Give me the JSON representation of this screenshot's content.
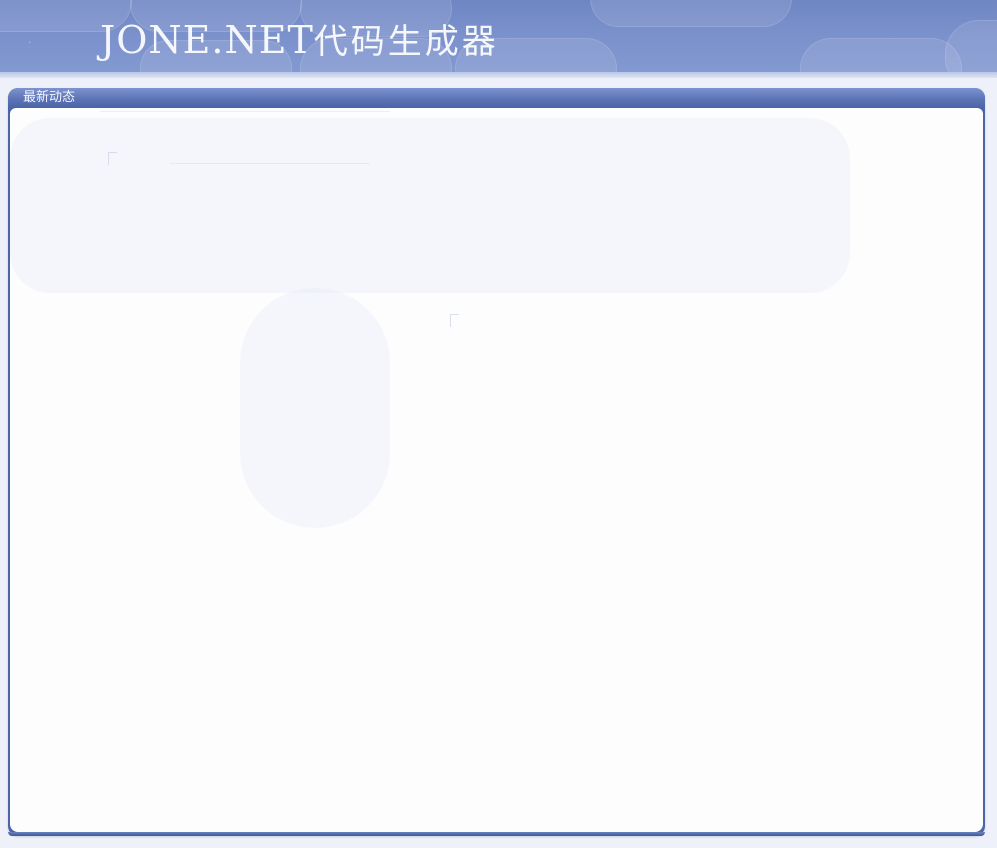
{
  "banner": {
    "title_latin": "JONE.NET",
    "title_cn": "代码生成器"
  },
  "panel": {
    "title": "最新动态"
  },
  "colors": {
    "banner": "#7b91cc",
    "panel_header": "#5c74b6",
    "panel_body": "#fdfdfe",
    "page_background": "#eef1f9"
  }
}
